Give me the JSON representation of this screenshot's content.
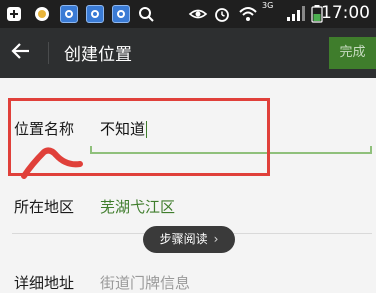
{
  "status_bar": {
    "time": "17:00",
    "network": "3G",
    "icons": [
      "plus-icon",
      "browser-icon",
      "app-icon",
      "app-icon",
      "app-icon",
      "search-icon",
      "eye-icon",
      "alarm-icon",
      "wifi-icon",
      "signal-icon",
      "battery-icon"
    ]
  },
  "header": {
    "back_icon": "arrow-left-icon",
    "title": "创建位置",
    "done_label": "完成"
  },
  "form": {
    "name_label": "位置名称",
    "name_value": "不知道",
    "region_label": "所在地区",
    "region_value": "芜湖弋江区",
    "address_label": "详细地址",
    "address_placeholder": "街道门牌信息"
  },
  "overlay": {
    "steps_label": "步骤阅读",
    "chevron_icon": "chevron-right-icon",
    "highlight_color": "#e0403a"
  },
  "colors": {
    "accent": "#3f7d2c",
    "header_bg": "#2d2f30"
  }
}
